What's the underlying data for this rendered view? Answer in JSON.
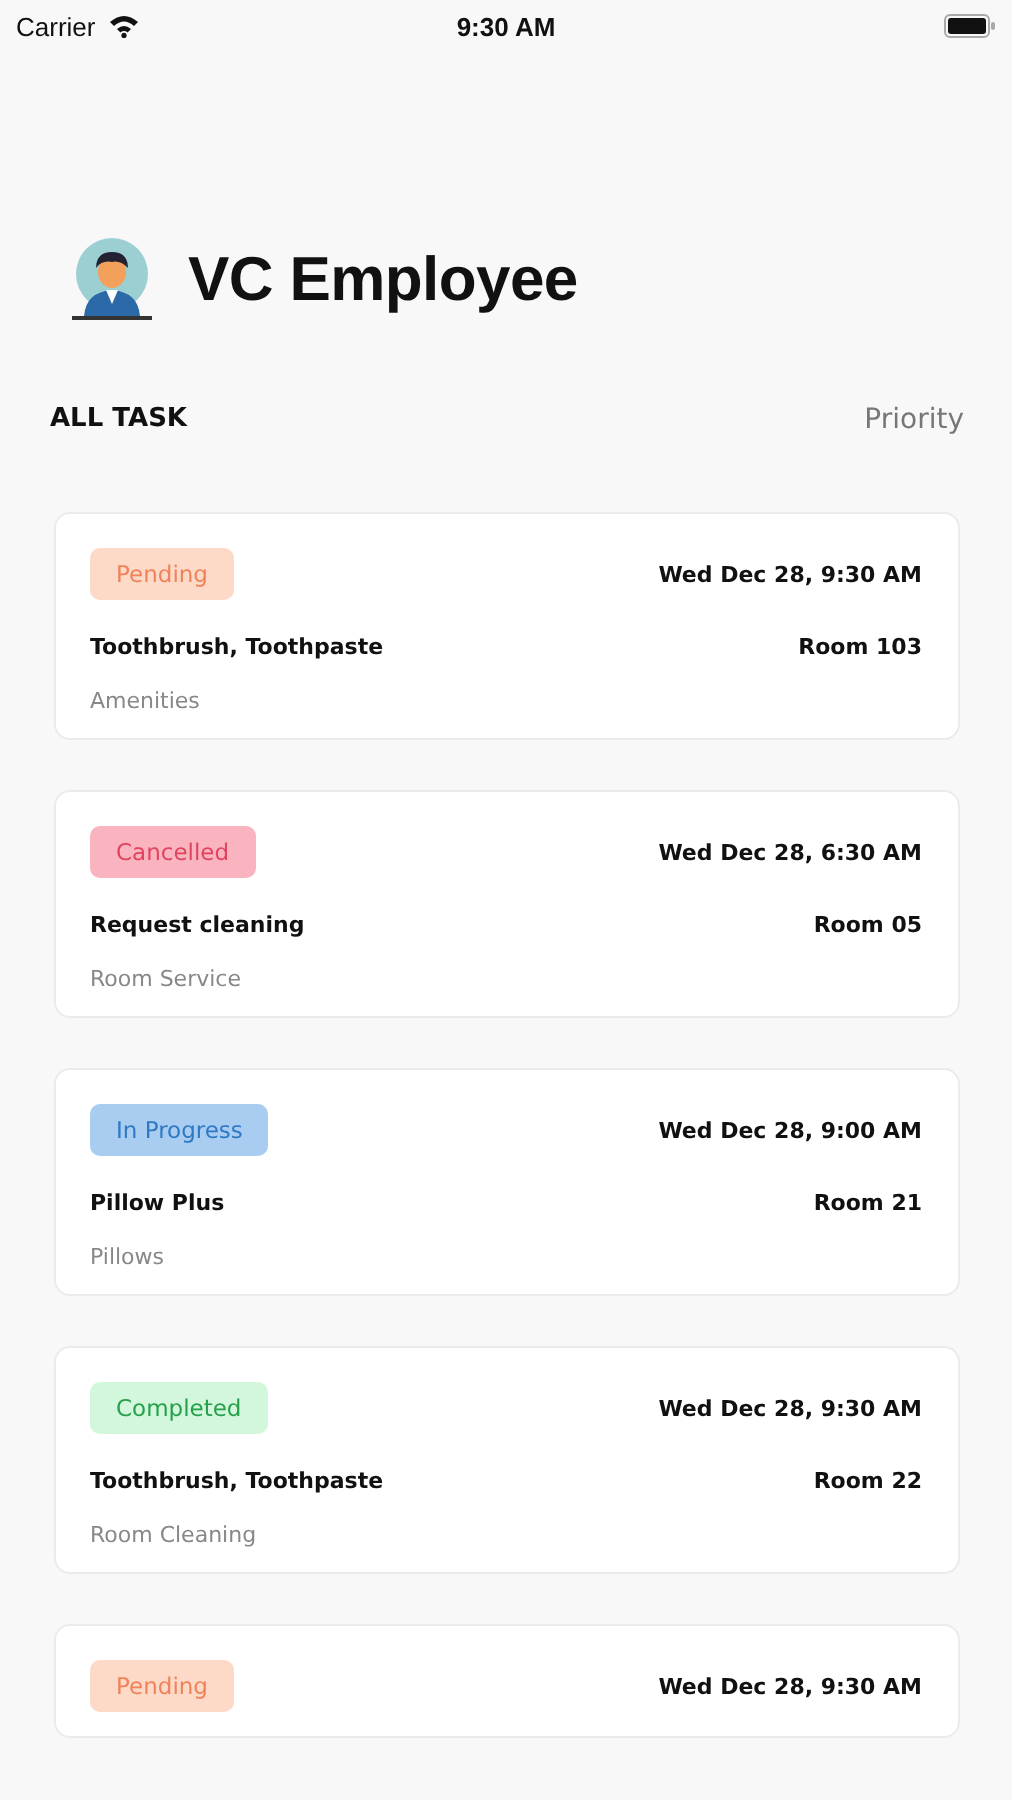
{
  "status_bar": {
    "carrier": "Carrier",
    "time": "9:30 AM"
  },
  "header": {
    "title": "VC Employee"
  },
  "filter": {
    "label": "ALL TASK",
    "sort": "Priority"
  },
  "tasks": [
    {
      "status": "Pending",
      "kind": "pending",
      "date": "Wed Dec 28, 9:30 AM",
      "item": "Toothbrush, Toothpaste",
      "room": "Room 103",
      "category": "Amenities"
    },
    {
      "status": "Cancelled",
      "kind": "cancelled",
      "date": "Wed Dec 28, 6:30 AM",
      "item": "Request cleaning",
      "room": "Room 05",
      "category": "Room Service"
    },
    {
      "status": "In Progress",
      "kind": "in_progress",
      "date": "Wed Dec 28, 9:00 AM",
      "item": "Pillow Plus",
      "room": "Room 21",
      "category": "Pillows"
    },
    {
      "status": "Completed",
      "kind": "completed",
      "date": "Wed Dec 28, 9:30 AM",
      "item": "Toothbrush, Toothpaste",
      "room": "Room 22",
      "category": "Room Cleaning"
    },
    {
      "status": "Pending",
      "kind": "pending",
      "date": "Wed Dec 28, 9:30 AM"
    }
  ]
}
